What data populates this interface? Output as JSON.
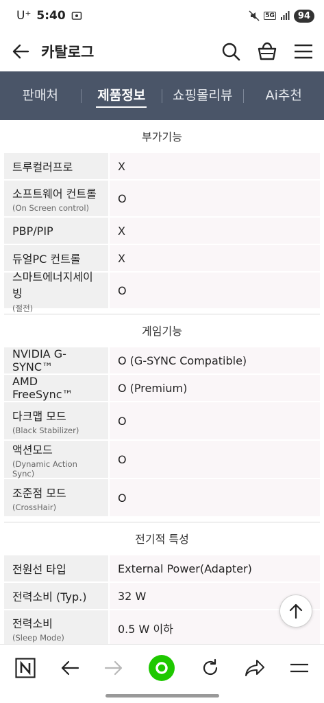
{
  "status": {
    "carrier": "U⁺",
    "time": "5:40",
    "battery": "94",
    "network": "5G"
  },
  "header": {
    "title": "카탈로그"
  },
  "tabs": [
    {
      "label": "판매처",
      "active": false
    },
    {
      "label": "제품정보",
      "active": true
    },
    {
      "label": "쇼핑몰리뷰",
      "active": false
    },
    {
      "label": "Ai추천",
      "active": false
    }
  ],
  "sections": {
    "extra": {
      "title": "부가기능",
      "rows": [
        {
          "key": "트루컬러프로",
          "value": "X"
        },
        {
          "key": "소프트웨어 컨트롤",
          "sub": "(On Screen control)",
          "value": "O"
        },
        {
          "key": "PBP/PIP",
          "value": "X"
        },
        {
          "key": "듀얼PC 컨트롤",
          "value": "X"
        },
        {
          "key": "스마트에너지세이빙",
          "sub": "(절전)",
          "value": "O"
        }
      ]
    },
    "game": {
      "title": "게임기능",
      "rows": [
        {
          "key": "NVIDIA G-SYNC™",
          "value": "O (G-SYNC Compatible)"
        },
        {
          "key": "AMD FreeSync™",
          "value": "O (Premium)"
        },
        {
          "key": "다크맵 모드",
          "sub": "(Black Stabilizer)",
          "value": "O"
        },
        {
          "key": "액션모드",
          "sub": "(Dynamic Action Sync)",
          "value": "O"
        },
        {
          "key": "조준점 모드",
          "sub": "(CrossHair)",
          "value": "O"
        }
      ]
    },
    "electric": {
      "title": "전기적 특성",
      "rows": [
        {
          "key": "전원선 타입",
          "value": "External Power(Adapter)"
        },
        {
          "key": "전력소비 (Typ.)",
          "value": "32 W"
        },
        {
          "key": "전력소비",
          "sub": "(Sleep Mode)",
          "value": "0.5 W 이하"
        }
      ]
    }
  },
  "colors": {
    "tab_bg": "#4a5568",
    "key_bg": "#f0f0f0",
    "value_bg": "#faf6f8",
    "accent_green": "#1ec800"
  }
}
